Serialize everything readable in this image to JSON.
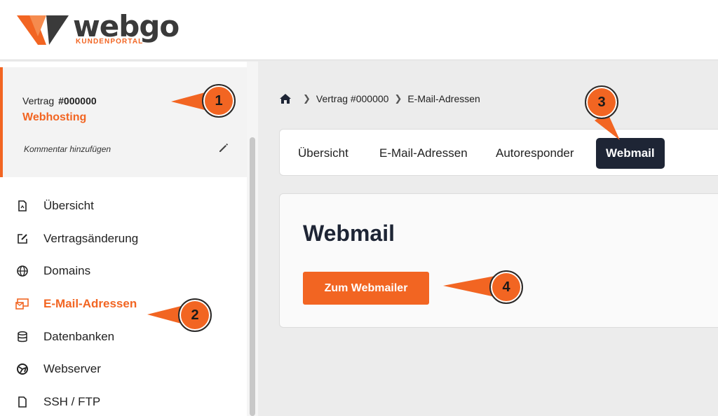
{
  "brand": {
    "name": "webgo",
    "subtitle": "KUNDENPORTAL",
    "color_primary": "#f26522",
    "color_dark": "#1e2535"
  },
  "contract": {
    "label": "Vertrag",
    "number": "#000000",
    "type": "Webhosting",
    "comment_link": "Kommentar hinzufügen"
  },
  "sidebar": {
    "items": [
      {
        "label": "Übersicht",
        "icon": "document-icon"
      },
      {
        "label": "Vertragsänderung",
        "icon": "edit-icon"
      },
      {
        "label": "Domains",
        "icon": "globe-icon"
      },
      {
        "label": "E-Mail-Adressen",
        "icon": "email-icon",
        "active": true
      },
      {
        "label": "Datenbanken",
        "icon": "database-icon"
      },
      {
        "label": "Webserver",
        "icon": "server-globe-icon"
      },
      {
        "label": "SSH / FTP",
        "icon": "file-icon"
      }
    ]
  },
  "breadcrumb": {
    "items": [
      "Vertrag #000000",
      "E-Mail-Adressen"
    ]
  },
  "tabs": [
    {
      "label": "Übersicht"
    },
    {
      "label": "E-Mail-Adressen"
    },
    {
      "label": "Autoresponder"
    },
    {
      "label": "Webmail",
      "active": true
    }
  ],
  "main": {
    "title": "Webmail",
    "button_label": "Zum Webmailer"
  },
  "callouts": [
    "1",
    "2",
    "3",
    "4"
  ]
}
